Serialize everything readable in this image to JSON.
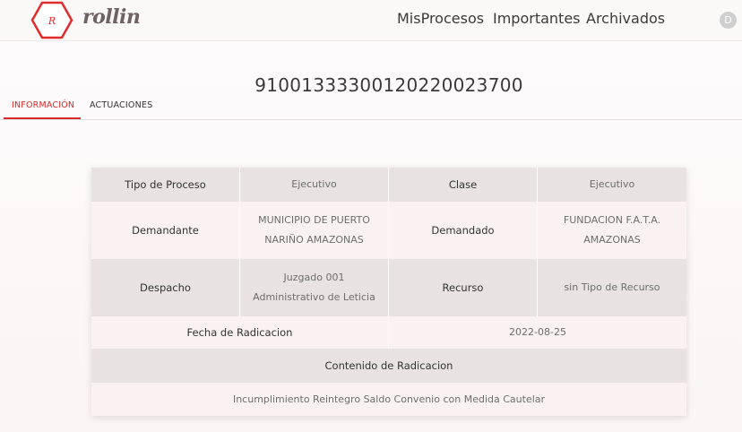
{
  "header": {
    "logo_letter": "R",
    "brand": "rollin",
    "nav": [
      "MisProcesos",
      "Importantes",
      "Archivados"
    ],
    "avatar_initial": "D"
  },
  "process": {
    "id": "91001333300120220023700"
  },
  "tabs": [
    "INFORMACIÓN",
    "ACTUACIONES"
  ],
  "info": {
    "tipo_proceso_label": "Tipo de Proceso",
    "tipo_proceso_value": "Ejecutivo",
    "clase_label": "Clase",
    "clase_value": "Ejecutivo",
    "demandante_label": "Demandante",
    "demandante_value": "MUNICIPIO DE PUERTO NARIÑO AMAZONAS",
    "demandado_label": "Demandado",
    "demandado_value": "FUNDACION F.A.T.A. AMAZONAS",
    "despacho_label": "Despacho",
    "despacho_value": "Juzgado 001 Administrativo de Leticia",
    "recurso_label": "Recurso",
    "recurso_value": "sin Tipo de Recurso",
    "fecha_label": "Fecha de Radicacion",
    "fecha_value": "2022-08-25",
    "contenido_label": "Contenido de Radicacion",
    "contenido_value": "Incumplimiento Reintegro Saldo Convenio con Medida Cautelar"
  },
  "colors": {
    "accent": "#d62a2a",
    "row_dark": "#e8e2e2",
    "row_light": "#faf2f2"
  }
}
